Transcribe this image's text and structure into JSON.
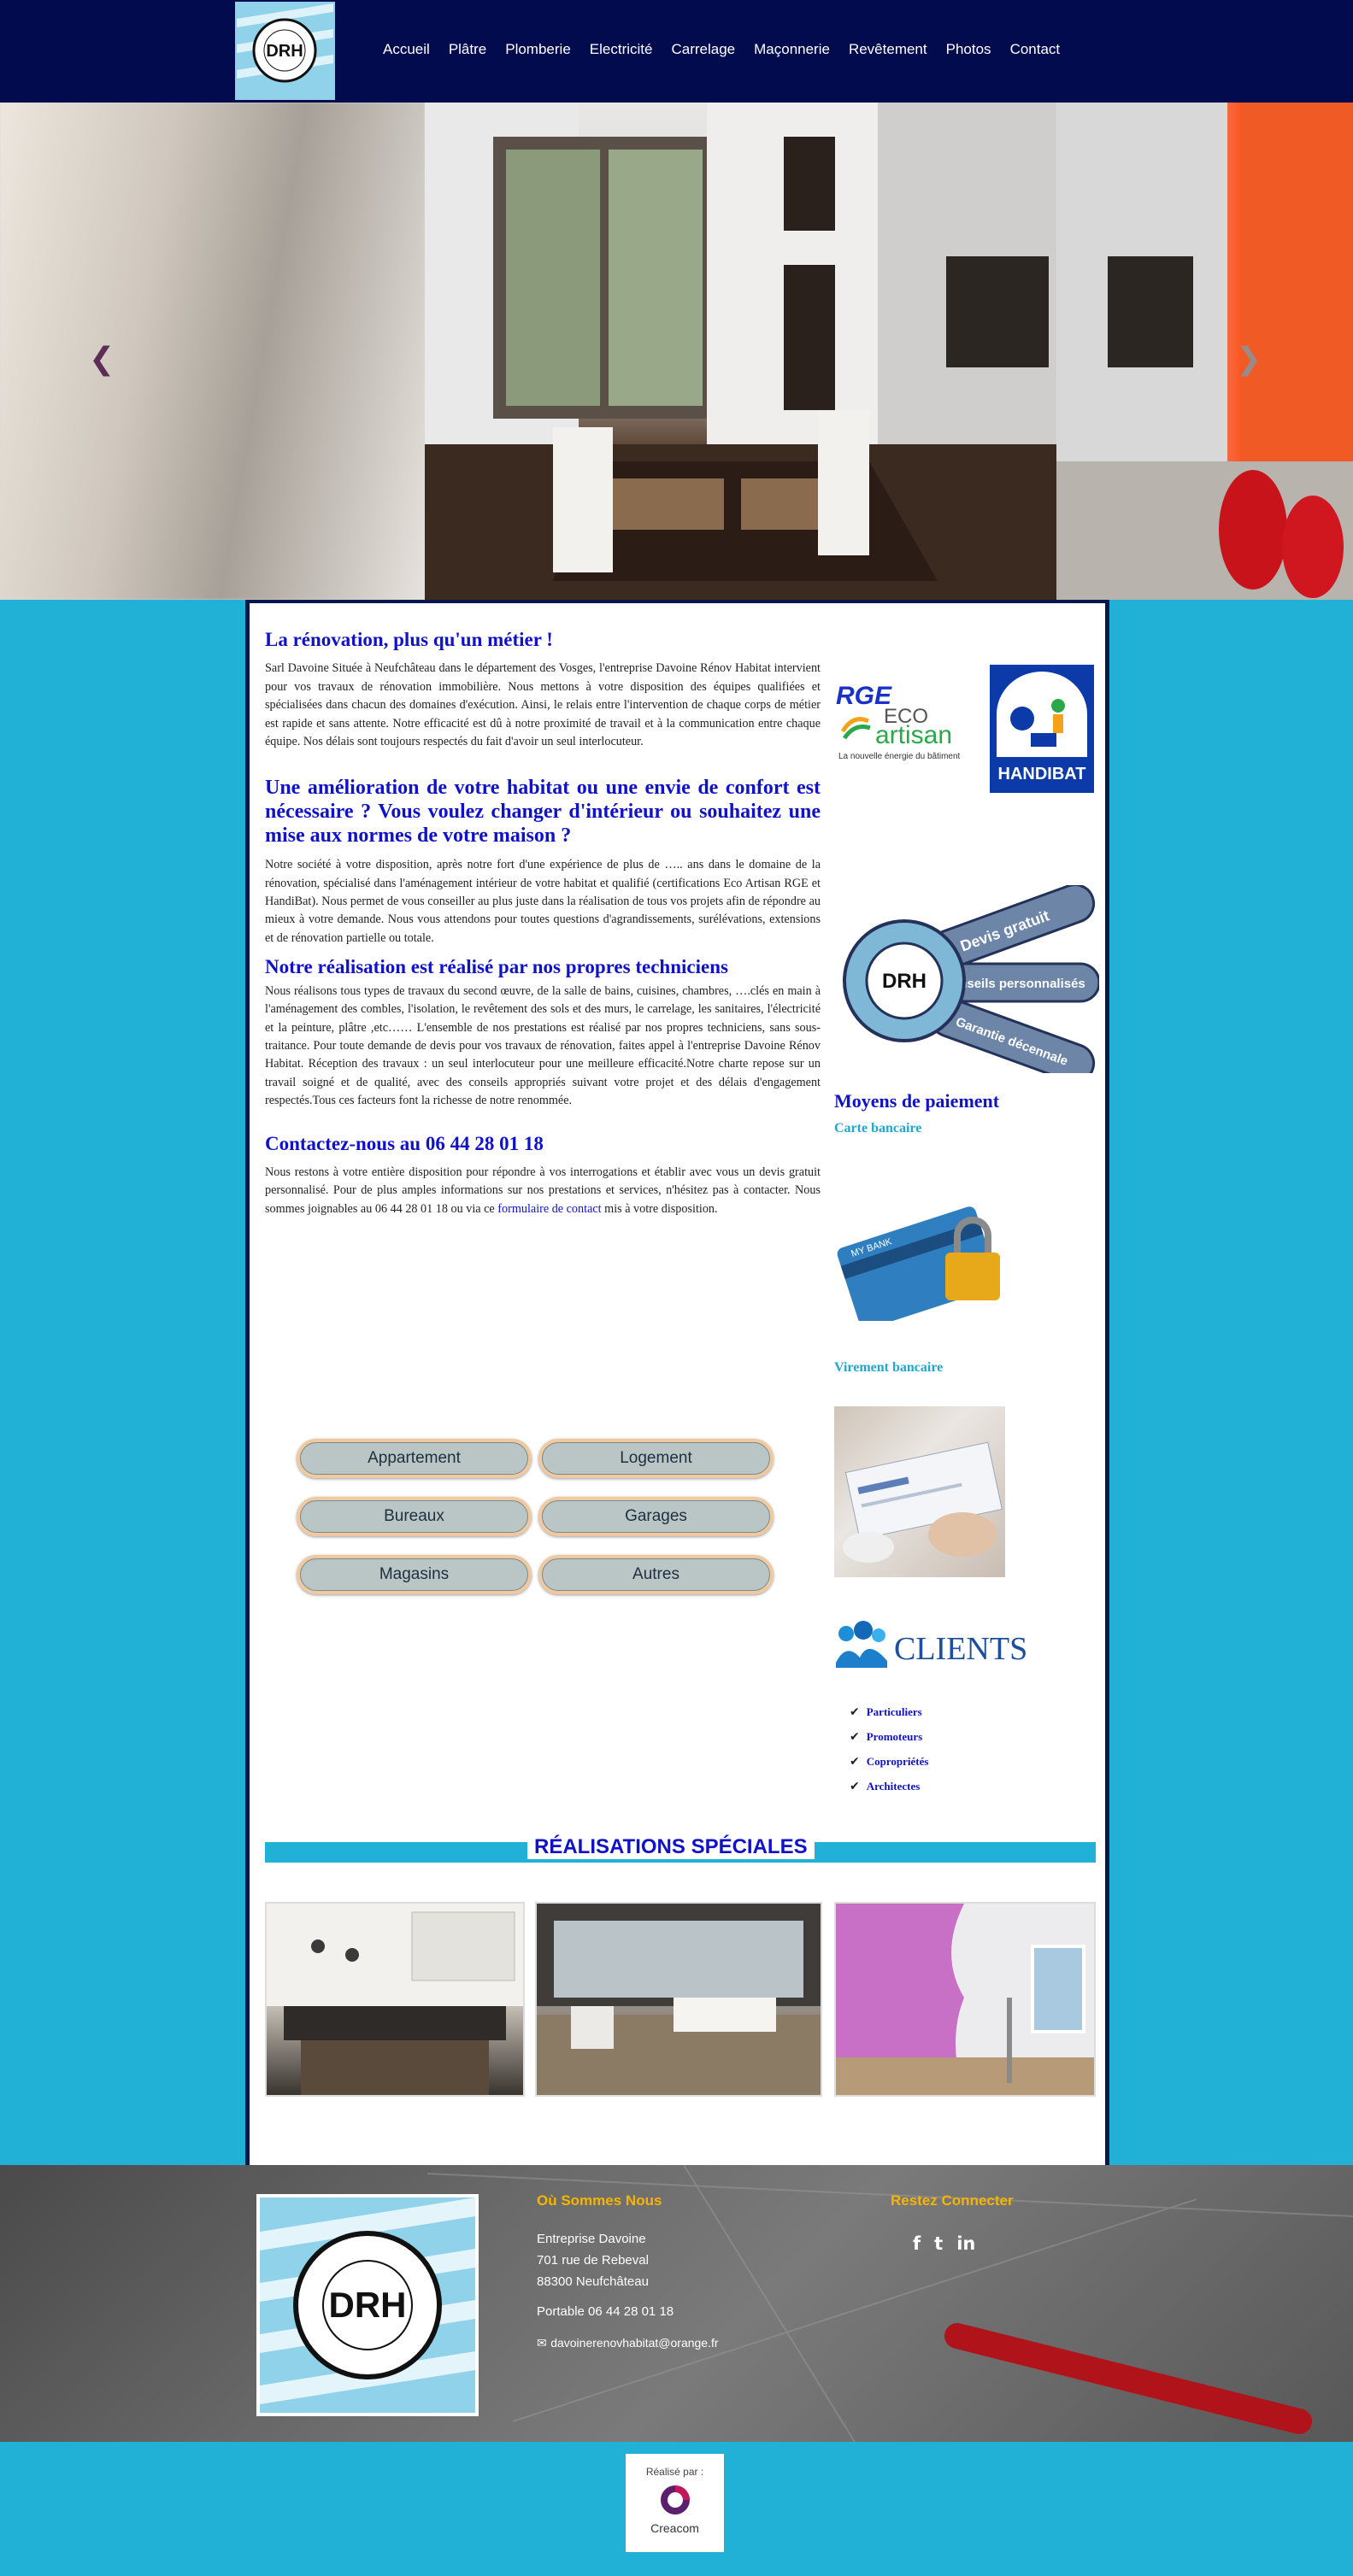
{
  "nav": {
    "logo_text": "DRH",
    "items": [
      "Accueil",
      "Plâtre",
      "Plomberie",
      "Electricité",
      "Carrelage",
      "Maçonnerie",
      "Revêtement",
      "Photos",
      "Contact"
    ]
  },
  "hero": {
    "prev_arrow": "❮",
    "next_arrow": "❯"
  },
  "intro": {
    "title": "La rénovation, plus qu'un métier !",
    "text": "Sarl Davoine Située à Neufchâteau dans le département des Vosges, l'entreprise Davoine Rénov Habitat intervient pour vos travaux de rénovation immobilière. Nous mettons à votre disposition des équipes qualifiées et spécialisées dans chacun des domaines d'exécution. Ainsi, le relais entre l'intervention de chaque corps de métier est rapide et sans attente. Notre efficacité est dû à notre proximité de travail et à la communication entre chaque équipe. Nos délais sont toujours respectés du fait d'avoir un seul interlocuteur."
  },
  "amelioration": {
    "title": "Une amélioration de votre habitat ou une envie de confort est nécessaire ? Vous voulez changer d'intérieur ou souhaitez une mise aux normes de votre maison ?",
    "text": "Notre société à votre  disposition, après notre fort d'une expérience de plus de ….. ans dans le domaine de la rénovation, spécialisé dans l'aménagement intérieur de votre habitat et qualifié (certifications Eco Artisan RGE et HandiBat). Nous permet de vous conseiller au plus juste dans la réalisation de tous vos projets afin de répondre au mieux à votre demande. Nous vous attendons pour toutes questions d'agrandissements, surélévations, extensions et de rénovation partielle ou totale."
  },
  "realisation": {
    "title": "Notre réalisation est réalisé par nos propres techniciens",
    "text": "Nous réalisons tous types de travaux du second œuvre, de la salle de bains, cuisines, chambres, ….clés en main à l'aménagement des combles, l'isolation, le revêtement des sols et des murs, le carrelage, les sanitaires, l'électricité et la peinture, plâtre ,etc…… L'ensemble de nos prestations est réalisé par nos propres techniciens, sans sous-traitance. Pour toute demande de devis pour vos travaux de rénovation, faites appel à l'entreprise Davoine Rénov Habitat. Réception des travaux : un seul interlocuteur pour une meilleure efficacité.Notre charte repose sur un travail soigné et de qualité, avec des conseils appropriés suivant votre projet et des délais d'engagement respectés.Tous ces facteurs font la richesse de notre renommée."
  },
  "contact": {
    "title": "Contactez-nous au 06 44 28 01 18",
    "text_before": "Nous restons à votre entière disposition pour répondre à vos interrogations et établir avec vous un devis gratuit  personnalisé. Pour de plus amples informations sur nos prestations et services, n'hésitez pas à contacter. Nous sommes joignables au 06 44 28 01 18 ou via ce ",
    "link": "formulaire de contact",
    "text_after": " mis à votre disposition."
  },
  "categories": [
    "Appartement",
    "Logement",
    "Bureaux",
    "Garages",
    "Magasins",
    "Autres"
  ],
  "badges": {
    "rge_top": "RGE",
    "rge_eco": "ECO",
    "rge_artisan": "artisan",
    "rge_sub": "La nouvelle énergie du bâtiment",
    "handibat": "HANDIBAT",
    "drh": "DRH",
    "emblem_lines": [
      "Devis gratuit",
      "Conseils personnalisés",
      "Garantie décennale"
    ]
  },
  "payment": {
    "title": "Moyens de paiement",
    "card": "Carte bancaire",
    "card_label": "MY BANK",
    "transfer": "Virement bancaire"
  },
  "clients": {
    "logo": "CLIENTS",
    "items": [
      "Particuliers",
      "Promoteurs",
      "Copropriétés",
      "Architectes"
    ]
  },
  "special": {
    "title": "RÉALISATIONS SPÉCIALES"
  },
  "footer": {
    "logo_text": "DRH",
    "where_title": "Où Sommes Nous",
    "company": "Entreprise Davoine",
    "street": "701 rue de Rebeval",
    "city": "88300  Neufchâteau",
    "phone": "Portable 06 44 28 01 18",
    "email": "davoinerenovhabitat@orange.fr",
    "social_title": "Restez Connecter",
    "socials": [
      "f",
      "t",
      "in"
    ]
  },
  "credit": {
    "label": "Réalisé par :",
    "brand": "Creacom"
  }
}
